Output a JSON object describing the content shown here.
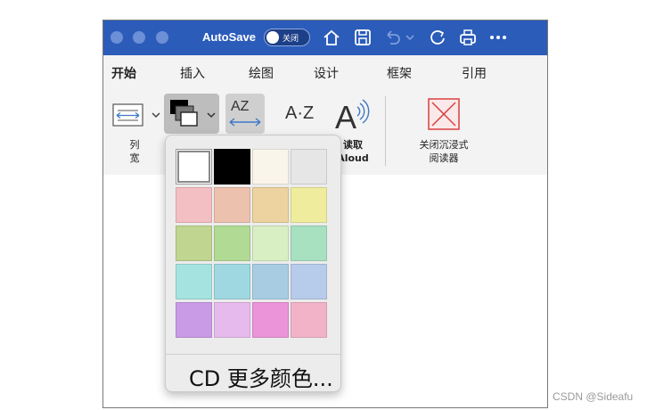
{
  "titlebar": {
    "autosave_label": "AutoSave",
    "toggle_label": "关闭",
    "icons": [
      "home-icon",
      "save-icon",
      "undo-icon",
      "chevron-down-icon",
      "redo-icon",
      "print-icon",
      "more-icon"
    ]
  },
  "menu": {
    "items": [
      {
        "label": "开始"
      },
      {
        "label": "插入"
      },
      {
        "label": "绘图"
      },
      {
        "label": "设计"
      },
      {
        "label": "框架"
      },
      {
        "label": "引用"
      }
    ]
  },
  "ribbon": {
    "column_width_label_1": "列",
    "column_width_label_2": "宽",
    "syllables_label": "AZ",
    "text_spacing_label": "A·Z",
    "read_aloud_label_1": "读取",
    "read_aloud_label_2": "Aloud",
    "close_label_1": "关闭沉浸式",
    "close_label_2": "阅读器"
  },
  "color_popup": {
    "colors": [
      "#ffffff",
      "#000000",
      "#faf5eb",
      "#e6e6e6",
      "#f4bfc2",
      "#ecc1ad",
      "#ecd39f",
      "#f0ec9d",
      "#bfd590",
      "#b1da94",
      "#d8efc3",
      "#a7e1c0",
      "#a4e3e0",
      "#9fd8e1",
      "#a8cde3",
      "#b7cbea",
      "#c99ae6",
      "#e7baee",
      "#eb94d9",
      "#f2b3c9"
    ],
    "selected_index": 0,
    "more_colors_label": "CD 更多颜色..."
  },
  "watermark": "CSDN @Sideafu"
}
